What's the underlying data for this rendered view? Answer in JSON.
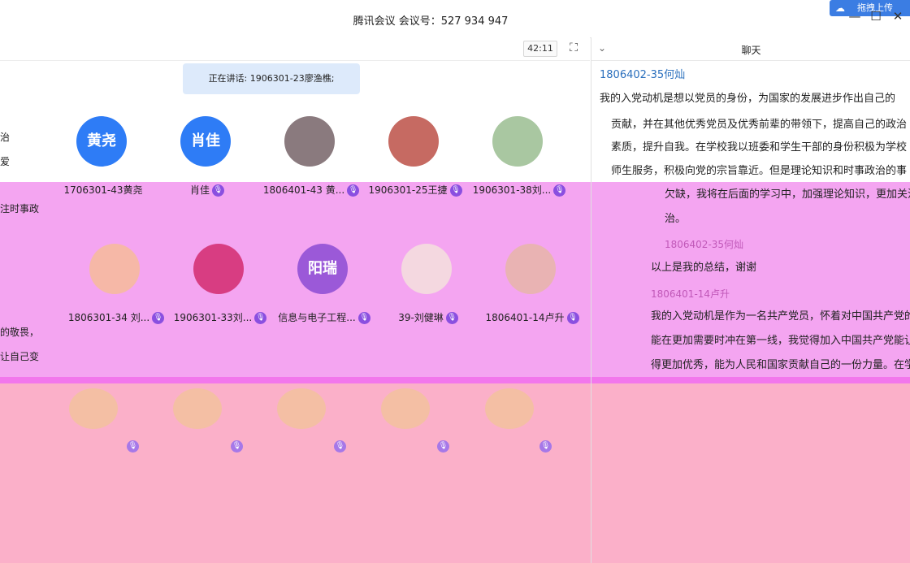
{
  "window": {
    "title": "腾讯会议 会议号：527 934 947",
    "upload_label": "拖拽上传",
    "upload_icon": "cloud-icon",
    "minimize": "—",
    "maximize": "☐",
    "close": "✕"
  },
  "toolbar": {
    "timer": "42:11",
    "fullscreen_icon": "fullscreen-icon"
  },
  "video": {
    "speaking": "正在讲话: 1906301-23廖渔樵;",
    "row1": [
      {
        "name": "1706301-43黄尧",
        "avatar_text": "黄尧",
        "color": "#2e7cf6",
        "mic": false
      },
      {
        "name": "肖佳",
        "avatar_text": "肖佳",
        "color": "#2e7cf6",
        "mic": true
      },
      {
        "name": "1806401-43 黄...",
        "avatar_text": "",
        "color": "#8a7a7e",
        "mic": true
      },
      {
        "name": "1906301-25王捷",
        "avatar_text": "",
        "color": "#c66a62",
        "mic": true
      },
      {
        "name": "1906301-38刘...",
        "avatar_text": "",
        "color": "#a9c7a1",
        "mic": true
      }
    ],
    "row2": [
      {
        "name": "1806301-34 刘...",
        "avatar_text": "",
        "color": "#f6b8a7",
        "mic": true
      },
      {
        "name": "1906301-33刘...",
        "avatar_text": "",
        "color": "#d83d82",
        "mic": true
      },
      {
        "name": "信息与电子工程...",
        "avatar_text": "阳瑞",
        "color": "#9b59d8",
        "mic": true
      },
      {
        "name": "39-刘健琳",
        "avatar_text": "",
        "color": "#f4d8e0",
        "mic": true
      },
      {
        "name": "1806401-14卢升",
        "avatar_text": "",
        "color": "#e9b3b3",
        "mic": true
      }
    ],
    "left_fragments": [
      "治",
      "爱",
      "注时事政",
      "的敬畏，",
      "让自己变"
    ]
  },
  "chat": {
    "title": "聊天",
    "chevron": "⌄",
    "messages": [
      {
        "sender": "1806402-35何灿",
        "lines": [
          "我的入党动机是想以党员的身份，为国家的发展进步作出自己的",
          "贡献，并在其他优秀党员及优秀前辈的带领下，提高自己的政治",
          "素质，提升自我。在学校我以班委和学生干部的身份积极为学校",
          "师生服务，积极向党的宗旨靠近。但是理论知识和时事政治的事",
          "欠缺，我将在后面的学习中，加强理论知识，更加关注时事政",
          "治。"
        ]
      },
      {
        "sender": "1806402-35何灿",
        "lines": [
          "以上是我的总结，谢谢"
        ]
      },
      {
        "sender": "1806401-14卢升",
        "lines": [
          "我的入党动机是作为一名共产党员，怀着对中国共产党的敬畏，",
          "能在更加需要时冲在第一线，我觉得加入中国共产党能让自己变",
          "得更加优秀，能为人民和国家贡献自己的一份力量。在学"
        ]
      }
    ]
  }
}
